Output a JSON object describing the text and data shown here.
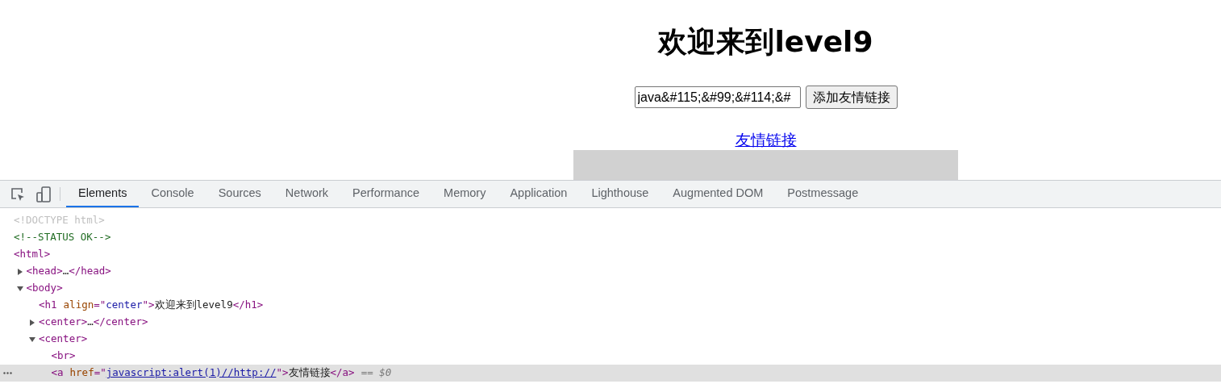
{
  "page": {
    "heading": "欢迎来到level9",
    "input": {
      "value": "java&#115;&#99;&#114;&#"
    },
    "submit_button": "添加友情链接",
    "link": "友情链接"
  },
  "devtools": {
    "tabs": [
      {
        "label": "Elements",
        "selected": true
      },
      {
        "label": "Console",
        "selected": false
      },
      {
        "label": "Sources",
        "selected": false
      },
      {
        "label": "Network",
        "selected": false
      },
      {
        "label": "Performance",
        "selected": false
      },
      {
        "label": "Memory",
        "selected": false
      },
      {
        "label": "Application",
        "selected": false
      },
      {
        "label": "Lighthouse",
        "selected": false
      },
      {
        "label": "Augmented DOM",
        "selected": false
      },
      {
        "label": "Postmessage",
        "selected": false
      }
    ],
    "dom_tree": [
      {
        "selected": false,
        "tokens": [
          {
            "kind": "doctype",
            "text": "<!DOCTYPE html>"
          }
        ]
      },
      {
        "selected": false,
        "tokens": [
          {
            "kind": "comment",
            "text": "<!--STATUS OK-->"
          }
        ]
      },
      {
        "selected": false,
        "tokens": [
          {
            "kind": "tag",
            "text": "<html>"
          }
        ],
        "children": [
          {
            "selected": false,
            "expanded": false,
            "tokens": [
              {
                "kind": "tag",
                "text": "<head>"
              },
              {
                "kind": "text",
                "text": "…"
              },
              {
                "kind": "tag",
                "text": "</head>"
              }
            ]
          },
          {
            "selected": false,
            "expanded": true,
            "tokens": [
              {
                "kind": "tag",
                "text": "<body>"
              }
            ],
            "children": [
              {
                "selected": false,
                "tokens": [
                  {
                    "kind": "tag",
                    "text": "<h1"
                  },
                  {
                    "kind": "attr_name",
                    "text": "align"
                  },
                  {
                    "kind": "tag",
                    "text": "=\""
                  },
                  {
                    "kind": "attr_value",
                    "text": "center"
                  },
                  {
                    "kind": "tag",
                    "text": "\">"
                  },
                  {
                    "kind": "text",
                    "text": "欢迎来到level9"
                  },
                  {
                    "kind": "tag",
                    "text": "</h1>"
                  }
                ]
              },
              {
                "selected": false,
                "expanded": false,
                "tokens": [
                  {
                    "kind": "tag",
                    "text": "<center>"
                  },
                  {
                    "kind": "text",
                    "text": "…"
                  },
                  {
                    "kind": "tag",
                    "text": "</center>"
                  }
                ]
              },
              {
                "selected": false,
                "expanded": true,
                "tokens": [
                  {
                    "kind": "tag",
                    "text": "<center>"
                  }
                ],
                "children": [
                  {
                    "selected": false,
                    "tokens": [
                      {
                        "kind": "tag",
                        "text": "<br>"
                      }
                    ]
                  },
                  {
                    "selected": true,
                    "tokens": [
                      {
                        "kind": "tag",
                        "text": "<a"
                      },
                      {
                        "kind": "attr_name",
                        "text": "href"
                      },
                      {
                        "kind": "tag",
                        "text": "=\""
                      },
                      {
                        "kind": "link",
                        "text": "javascript:alert(1)//http://"
                      },
                      {
                        "kind": "tag",
                        "text": "\">"
                      },
                      {
                        "kind": "text",
                        "text": "友情链接"
                      },
                      {
                        "kind": "tag",
                        "text": "</a>"
                      },
                      {
                        "kind": "marker",
                        "text": "== $0"
                      }
                    ]
                  }
                ]
              }
            ]
          }
        ]
      }
    ]
  }
}
